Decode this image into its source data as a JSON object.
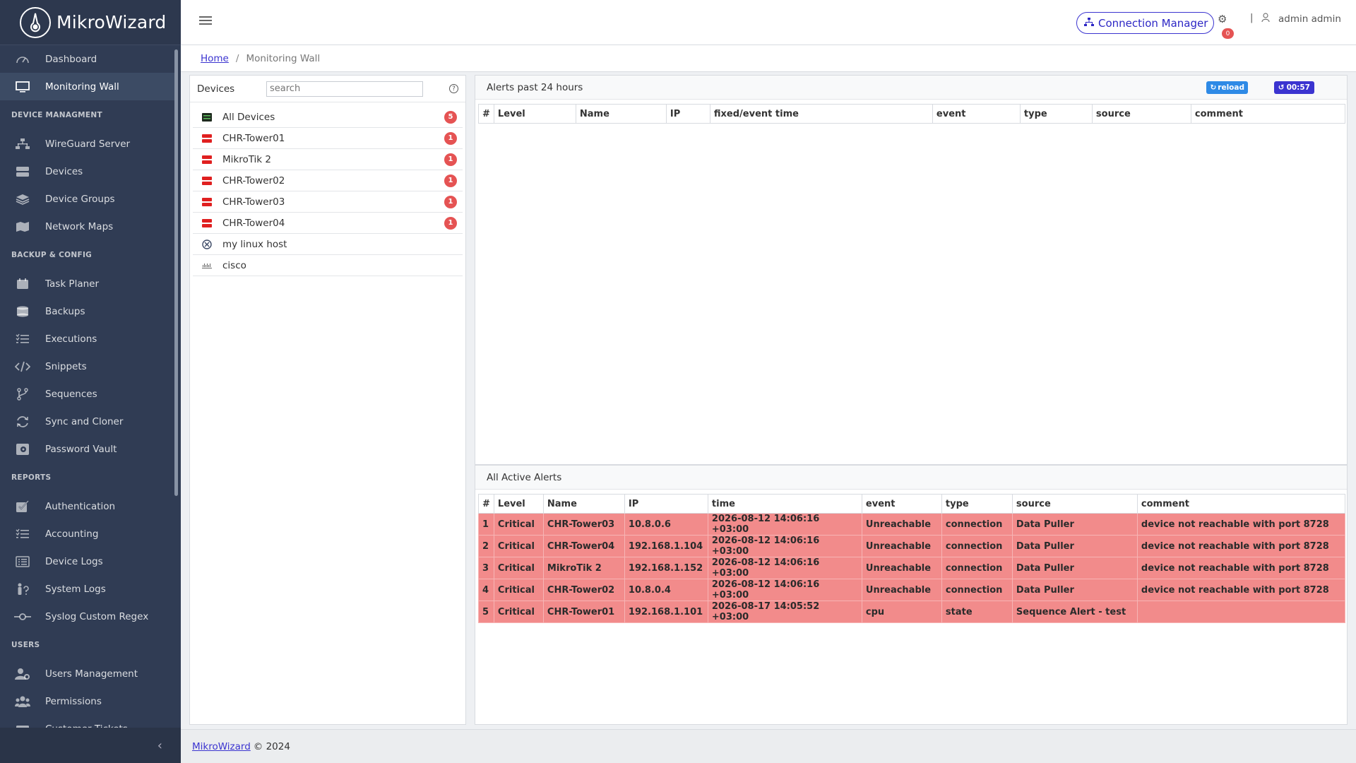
{
  "brand": {
    "name": "MikroWizard"
  },
  "sidebar": {
    "items": [
      {
        "type": "item",
        "label": "Dashboard",
        "icon": "speedometer-icon"
      },
      {
        "type": "item",
        "label": "Monitoring Wall",
        "icon": "monitor-icon",
        "active": true
      },
      {
        "type": "title",
        "label": "DEVICE MANAGMENT"
      },
      {
        "type": "item",
        "label": "WireGuard Server",
        "icon": "network-icon"
      },
      {
        "type": "item",
        "label": "Devices",
        "icon": "server-icon"
      },
      {
        "type": "item",
        "label": "Device Groups",
        "icon": "layers-icon"
      },
      {
        "type": "item",
        "label": "Network Maps",
        "icon": "map-icon"
      },
      {
        "type": "title",
        "label": "BACKUP & CONFIG"
      },
      {
        "type": "item",
        "label": "Task Planer",
        "icon": "calendar-icon"
      },
      {
        "type": "item",
        "label": "Backups",
        "icon": "database-icon"
      },
      {
        "type": "item",
        "label": "Executions",
        "icon": "list-check-icon"
      },
      {
        "type": "item",
        "label": "Snippets",
        "icon": "code-icon"
      },
      {
        "type": "item",
        "label": "Sequences",
        "icon": "branch-icon"
      },
      {
        "type": "item",
        "label": "Sync and Cloner",
        "icon": "sync-icon"
      },
      {
        "type": "item",
        "label": "Password Vault",
        "icon": "vault-icon"
      },
      {
        "type": "title",
        "label": "REPORTS"
      },
      {
        "type": "item",
        "label": "Authentication",
        "icon": "check-square-icon"
      },
      {
        "type": "item",
        "label": "Accounting",
        "icon": "list-check-icon"
      },
      {
        "type": "item",
        "label": "Device Logs",
        "icon": "list-icon"
      },
      {
        "type": "item",
        "label": "System Logs",
        "icon": "person-question-icon"
      },
      {
        "type": "item",
        "label": "Syslog Custom Regex",
        "icon": "commit-icon"
      },
      {
        "type": "title",
        "label": "USERS"
      },
      {
        "type": "item",
        "label": "Users Management",
        "icon": "user-gear-icon"
      },
      {
        "type": "item",
        "label": "Permissions",
        "icon": "users-icon"
      },
      {
        "type": "item",
        "label": "Customer Tickets",
        "icon": "ticket-icon"
      }
    ]
  },
  "header": {
    "connection_manager": "Connection Manager",
    "notification_count": "0",
    "separator": "|",
    "user": "admin admin"
  },
  "breadcrumb": {
    "home": "Home",
    "separator": "/",
    "current": "Monitoring Wall"
  },
  "devices_panel": {
    "title": "Devices",
    "search_placeholder": "search",
    "help": "?",
    "devices": [
      {
        "name": "All Devices",
        "count": "5",
        "icon": "all-devices-icon",
        "icon_color": "#1e2a1e"
      },
      {
        "name": "CHR-Tower01",
        "count": "1",
        "icon": "router-down-icon",
        "icon_color": "#e02020"
      },
      {
        "name": "MikroTik 2",
        "count": "1",
        "icon": "router-down-icon",
        "icon_color": "#e02020"
      },
      {
        "name": "CHR-Tower02",
        "count": "1",
        "icon": "router-down-icon",
        "icon_color": "#e02020"
      },
      {
        "name": "CHR-Tower03",
        "count": "1",
        "icon": "router-down-icon",
        "icon_color": "#e02020"
      },
      {
        "name": "CHR-Tower04",
        "count": "1",
        "icon": "router-down-icon",
        "icon_color": "#e02020"
      },
      {
        "name": "my linux host",
        "count": "",
        "icon": "linux-host-icon",
        "icon_color": "#3d4a66"
      },
      {
        "name": "cisco",
        "count": "",
        "icon": "cisco-icon",
        "icon_color": "#666666"
      }
    ]
  },
  "alerts_24h": {
    "title": "Alerts past 24 hours",
    "reload_label": "reload",
    "timer_label": "00:57",
    "columns": [
      "#",
      "Level",
      "Name",
      "IP",
      "fixed/event time",
      "event",
      "type",
      "source",
      "comment"
    ],
    "rows": []
  },
  "active_alerts": {
    "title": "All Active Alerts",
    "columns": [
      "#",
      "Level",
      "Name",
      "IP",
      "time",
      "event",
      "type",
      "source",
      "comment"
    ],
    "rows": [
      [
        "1",
        "Critical",
        "CHR-Tower03",
        "10.8.0.6",
        "2026-08-12 14:06:16 +03:00",
        "Unreachable",
        "connection",
        "Data Puller",
        "device not reachable with port 8728"
      ],
      [
        "2",
        "Critical",
        "CHR-Tower04",
        "192.168.1.104",
        "2026-08-12 14:06:16 +03:00",
        "Unreachable",
        "connection",
        "Data Puller",
        "device not reachable with port 8728"
      ],
      [
        "3",
        "Critical",
        "MikroTik 2",
        "192.168.1.152",
        "2026-08-12 14:06:16 +03:00",
        "Unreachable",
        "connection",
        "Data Puller",
        "device not reachable with port 8728"
      ],
      [
        "4",
        "Critical",
        "CHR-Tower02",
        "10.8.0.4",
        "2026-08-12 14:06:16 +03:00",
        "Unreachable",
        "connection",
        "Data Puller",
        "device not reachable with port 8728"
      ],
      [
        "5",
        "Critical",
        "CHR-Tower01",
        "192.168.1.101",
        "2026-08-17 14:05:52 +03:00",
        "cpu",
        "state",
        "Sequence Alert - test",
        ""
      ]
    ]
  },
  "footer": {
    "link": "MikroWizard",
    "text": "© 2024"
  },
  "colors": {
    "sidebar_bg": "#303c54",
    "accent": "#3b34d0",
    "critical_row": "#f28b8b",
    "badge": "#e55353",
    "reload_btn": "#2e8ae6"
  }
}
